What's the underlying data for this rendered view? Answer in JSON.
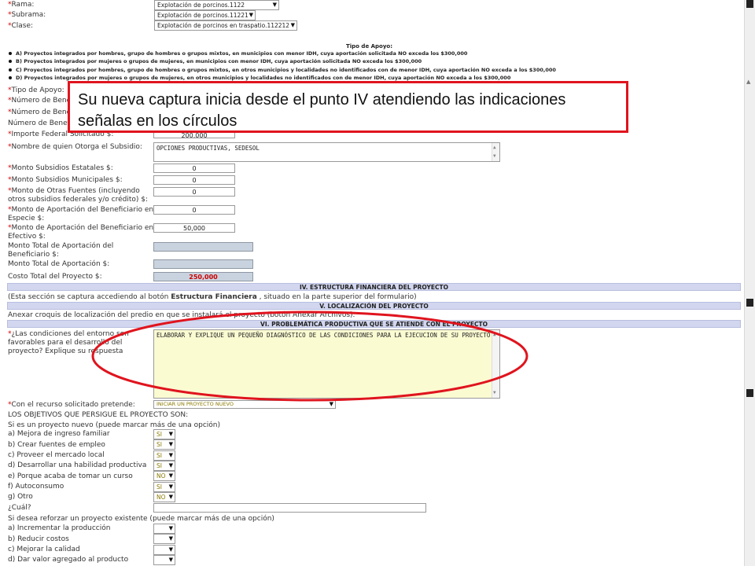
{
  "form": {
    "rama": {
      "label": "Rama:",
      "value": "Explotación de porcinos.1122"
    },
    "subrama": {
      "label": "Subrama:",
      "value": "Explotación de porcinos.11221"
    },
    "clase": {
      "label": "Clase:",
      "value": "Explotación de porcinos en traspatio.112212"
    },
    "tipo_apoyo_heading": "Tipo de Apoyo:",
    "tipo_apoyo_options": [
      "A) Proyectos integrados por hombres, grupo de hombres o grupos mixtos, en municipios con menor IDH, cuya aportación solicitada NO exceda los $300,000",
      "B) Proyectos integrados por mujeres o grupos de mujeres, en municipios con menor IDH, cuya aportación solicitada NO exceda los $300,000",
      "C) Proyectos integrados por hombres, grupo de hombres o grupos mixtos, en otros municipios y localidades no identificados con de menor IDH, cuya aportación NO exceda a los $300,000",
      "D) Proyectos integrados por mujeres o grupos de mujeres, en otros municipios y localidades no identificados con de menor IDH, cuya aportación NO exceda a los $300,000"
    ],
    "tipo_apoyo_label": "Tipo de Apoyo:",
    "numero_bene_1": "Número de Bene",
    "numero_bene_2": "Número de Bene",
    "numero_bene_3": "Número de Benef",
    "importe_federal": {
      "label": "Importe Federal Solicitado $:",
      "value": "200,000"
    },
    "nombre_otorga": {
      "label": "Nombre de quien Otorga el Subsidio:",
      "value": "OPCIONES PRODUCTIVAS, SEDESOL"
    },
    "monto_estatales": {
      "label": "Monto Subsidios Estatales $:",
      "value": "0"
    },
    "monto_municipales": {
      "label": "Monto Subsidios Municipales $:",
      "value": "0"
    },
    "monto_otras_1": "Monto de Otras Fuentes (incluyendo",
    "monto_otras_2": "otros subsidios federales y/o crédito) $:",
    "monto_otras_value": "0",
    "aport_especie_1": "Monto de Aportación del Beneficiario en",
    "aport_especie_2": "Especie $:",
    "aport_especie_value": "0",
    "aport_efectivo_1": "Monto de Aportación del Beneficiario en",
    "aport_efectivo_2": "Efectivo $:",
    "aport_efectivo_value": "50,000",
    "total_benef_1": "Monto Total de Aportación del",
    "total_benef_2": "Beneficiario $:",
    "total_aport": "Monto Total de Aportación $:",
    "costo_total": {
      "label": "Costo Total del Proyecto $:",
      "value": "250,000"
    }
  },
  "sections": {
    "iv_title": "IV. ESTRUCTURA FINANCIERA DEL PROYECTO",
    "iv_note_pre": "(Esta sección se captura accediendo al botón",
    "iv_note_bold": "Estructura Financiera",
    "iv_note_post": ", situado en la parte superior del formulario)",
    "v_title": "V. LOCALIZACIÓN DEL PROYECTO",
    "v_note": "Anexar croquis de localización del predio en que se instalará el proyecto (botón Anexar Archivos).",
    "vi_title": "VI. PROBLEMÁTICA PRODUCTIVA QUE SE ATIENDE CON EL PROYECTO",
    "vi_q1": "¿Las condiciones del entorno son",
    "vi_q2": "favorables para el desarrollo del",
    "vi_q3": "proyecto? Explique su respuesta",
    "vi_answer": "ELABORAR Y EXPLIQUE UN PEQUEÑO DIAGNÓSTICO DE LAS CONDICIONES PARA LA EJECUCION DE SU PROYECTO"
  },
  "objectives": {
    "recurso_label": "Con el recurso solicitado pretende:",
    "recurso_value": "INICIAR UN PROYECTO NUEVO",
    "heading": "LOS OBJETIVOS QUE PERSIGUE EL PROYECTO SON:",
    "nuevo_heading": "Si es un proyecto nuevo (puede marcar más de una opción)",
    "nuevo_items": [
      {
        "label": "a) Mejora de ingreso familiar",
        "value": "SI"
      },
      {
        "label": "b) Crear fuentes de empleo",
        "value": "SI"
      },
      {
        "label": "c) Proveer el mercado local",
        "value": "SI"
      },
      {
        "label": "d) Desarrollar una habilidad productiva",
        "value": "SI"
      },
      {
        "label": "e) Porque acaba de tomar un curso",
        "value": "NO"
      },
      {
        "label": "f) Autoconsumo",
        "value": "SI"
      },
      {
        "label": "g) Otro",
        "value": "NO"
      }
    ],
    "cual_label": "¿Cuál?",
    "existente_heading": "Si desea reforzar un proyecto existente (puede marcar más de una opción)",
    "existente_items": [
      {
        "label": "a) Incrementar la producción",
        "value": ""
      },
      {
        "label": "b) Reducir costos",
        "value": ""
      },
      {
        "label": "c) Mejorar la calidad",
        "value": ""
      },
      {
        "label": "d) Dar valor agregado al producto",
        "value": ""
      }
    ]
  },
  "callout": {
    "text": "Su nueva captura inicia desde el punto IV atendiendo las indicaciones señalas en los círculos",
    "border_color": "#e0141e",
    "circle_color": "#e0141e"
  },
  "icons": {
    "select_arrow": "▼",
    "scroll_up": "▲",
    "scroll_down": "▼",
    "required_marker": "*"
  }
}
